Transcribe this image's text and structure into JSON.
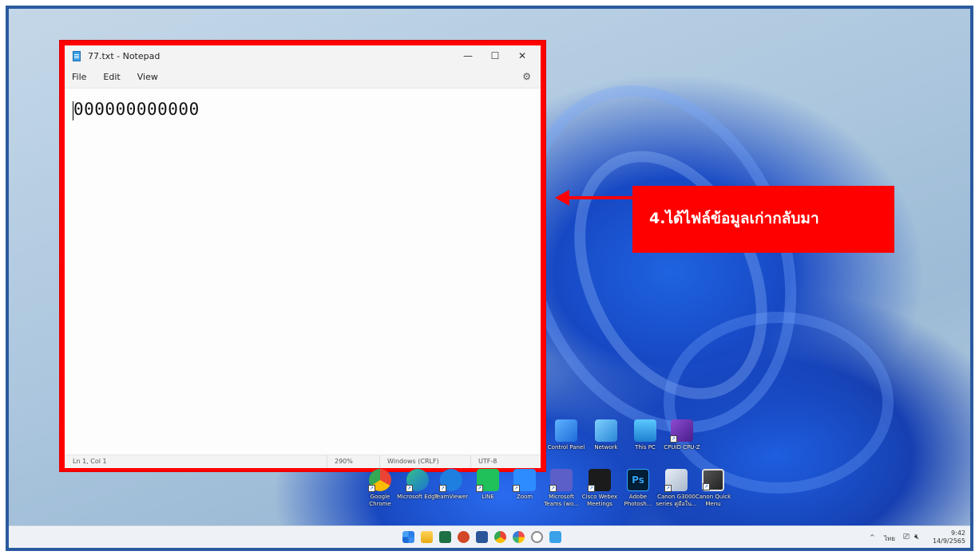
{
  "notepad": {
    "title": "77.txt - Notepad",
    "menu": [
      "File",
      "Edit",
      "View"
    ],
    "content": "000000000000",
    "status": {
      "position": "Ln 1, Col 1",
      "zoom": "290%",
      "line_ending": "Windows (CRLF)",
      "encoding": "UTF-8"
    },
    "controls": {
      "minimize": "—",
      "maximize": "☐",
      "close": "✕"
    }
  },
  "callout": {
    "text": "4.ได้ไฟล์ข้อมูลเก่ากลับมา",
    "color": "#ff0000"
  },
  "desktop_icons_top": [
    {
      "label": "Control Panel",
      "icon": "control-panel-icon"
    },
    {
      "label": "Network",
      "icon": "network-icon"
    },
    {
      "label": "This PC",
      "icon": "this-pc-icon"
    },
    {
      "label": "CPUID CPU-Z",
      "icon": "cpuz-icon"
    }
  ],
  "desktop_icons_bottom": [
    {
      "label": "Google Chrome",
      "icon": "chrome-icon"
    },
    {
      "label": "Microsoft Edge",
      "icon": "edge-icon"
    },
    {
      "label": "TeamViewer",
      "icon": "teamviewer-icon"
    },
    {
      "label": "LINE",
      "icon": "line-icon"
    },
    {
      "label": "Zoom",
      "icon": "zoom-icon"
    },
    {
      "label": "Microsoft Teams (wo...",
      "icon": "teams-icon"
    },
    {
      "label": "Cisco Webex Meetings",
      "icon": "webex-icon"
    },
    {
      "label": "Adobe Photosh...",
      "icon": "photoshop-icon"
    },
    {
      "label": "Canon G3000 series คู่มือใน...",
      "icon": "canon-manual-icon"
    },
    {
      "label": "Canon Quick Menu",
      "icon": "canon-quick-menu-icon"
    }
  ],
  "taskbar": {
    "apps": [
      "start-icon",
      "file-explorer-icon",
      "excel-icon",
      "powerpoint-icon",
      "word-icon",
      "chrome-icon",
      "paint-icon",
      "clock-icon",
      "notepad-icon"
    ],
    "tray": {
      "chevron": "^",
      "language": "ไทย",
      "time": "9:42",
      "date": "14/9/2565"
    }
  },
  "colors": {
    "frame": "#2a5aa0",
    "highlight": "#ff0000"
  }
}
